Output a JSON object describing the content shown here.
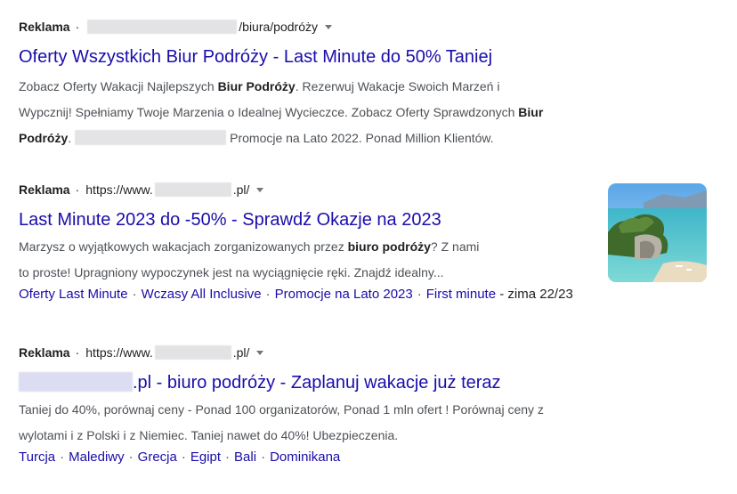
{
  "ads": [
    {
      "label": "Reklama",
      "dot": "·",
      "url_suffix": "/biura/podróży",
      "title": "Oferty Wszystkich Biur Podróży - Last Minute do 50% Taniej",
      "desc": {
        "t1": "Zobacz Oferty Wakacji Najlepszych ",
        "b1": "Biur Podróży",
        "t2": ". Rezerwuj Wakacje Swoich Marzeń i",
        "t3": "Wypcznij! Spełniamy Twoje Marzenia o Idealnej Wycieczce. Zobacz Oferty Sprawdzonych ",
        "b2": "Biur",
        "b3": "Podróży",
        "t4": ".",
        "t5": "Promocje na Lato 2022. Ponad Million Klientów."
      }
    },
    {
      "label": "Reklama",
      "dot": "·",
      "url_prefix": "https://www.",
      "url_suffix": ".pl/",
      "title": "Last Minute 2023 do -50% - Sprawdź Okazje na 2023",
      "desc": {
        "t1": "Marzysz o wyjątkowych wakacjach zorganizowanych przez ",
        "b1": "biuro podróży",
        "t2": "? Z nami",
        "t3": "to proste! Upragniony wypoczynek jest na wyciągnięcie ręki. Znajdź idealny..."
      },
      "sitelinks": [
        "Oferty Last Minute",
        "Wczasy All Inclusive",
        "Promocje na Lato 2023",
        "First minute"
      ],
      "sitelink_tail": "- zima 22/23",
      "sep": "·"
    },
    {
      "label": "Reklama",
      "dot": "·",
      "url_prefix": "https://www.",
      "url_suffix": ".pl/",
      "title_suffix": ".pl - biuro podróży - Zaplanuj wakacje już teraz",
      "desc": {
        "t1": "Taniej do 40%, porównaj ceny - Ponad 100 organizatorów, Ponad 1 mln ofert ! Porównaj ceny z",
        "t2": "wylotami i z Polski i z Niemiec. Taniej nawet do 40%! Ubezpieczenia."
      },
      "sitelinks": [
        "Turcja",
        "Malediwy",
        "Grecja",
        "Egipt",
        "Bali",
        "Dominikana"
      ],
      "sep": "·"
    }
  ],
  "icons": {
    "dropdown": "caret-down-icon",
    "thumbnail": "coastal-rock-photo"
  },
  "colors": {
    "link": "#1a0dab",
    "text": "#4d5156",
    "dark": "#202124"
  }
}
